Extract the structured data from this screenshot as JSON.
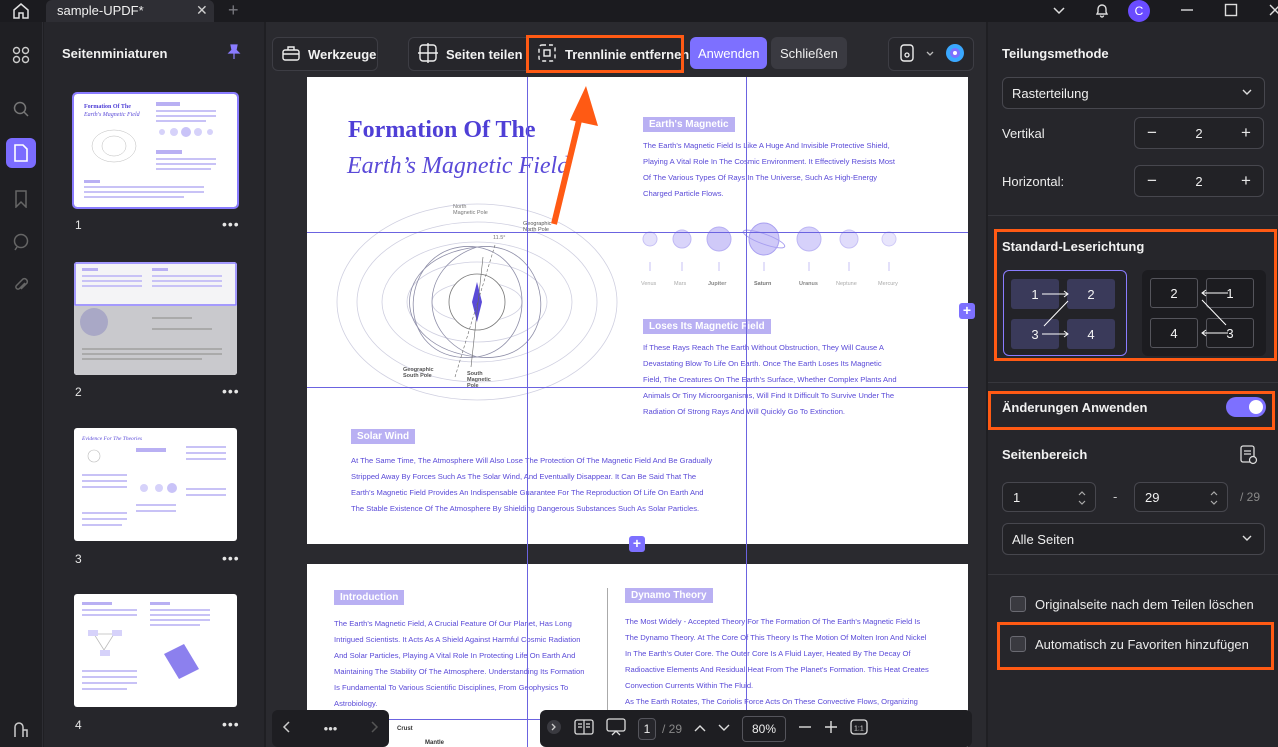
{
  "titlebar": {
    "tab_title": "sample-UPDF*",
    "tab_close": "✕",
    "new_tab": "+",
    "avatar_letter": "C"
  },
  "thumbnails": {
    "title": "Seitenminiaturen",
    "pages": [
      {
        "num": "1",
        "more": "•••"
      },
      {
        "num": "2",
        "more": "•••"
      },
      {
        "num": "3",
        "more": "•••"
      },
      {
        "num": "4",
        "more": "•••"
      }
    ]
  },
  "toolbar": {
    "tools_label": "Werkzeuge",
    "split_label": "Seiten teilen",
    "remove_divider_label": "Trennlinie entfernen",
    "apply_label": "Anwenden",
    "close_label": "Schließen"
  },
  "page1": {
    "title_line1": "Formation Of The",
    "title_line2": "Earth’s Magnetic Field",
    "section1_chip": "Earth's Magnetic",
    "section1_lines": [
      "The Earth's Magnetic Field Is Like A Huge And Invisible Protective Shield,",
      "Playing A Vital Role In The Cosmic Environment. It Effectively Resists Most",
      "Of The Various Types Of Rays In The Universe, Such As High-Energy",
      "Charged Particle Flows."
    ],
    "planets": [
      "Venus",
      "Mars",
      "Jupiter",
      "Saturn",
      "Uranus",
      "Neptune",
      "Mercury"
    ],
    "section2_chip": "Loses Its Magnetic Field",
    "section2_lines": [
      "If These Rays Reach The Earth Without Obstruction, They Will Cause A",
      "Devastating Blow To Life On Earth. Once The Earth Loses Its Magnetic",
      "Field, The Creatures On The Earth's Surface, Whether Complex Plants And",
      "Animals Or Tiny Microorganisms, Will Find It Difficult To Survive Under The",
      "Radiation Of Strong Rays And Will Quickly Go To Extinction."
    ],
    "diagram_labels": {
      "north_mag": "North\nMagnetic Pole",
      "geo_north": "Geographic\nNorth Pole",
      "geo_south": "Geographic\nSouth Pole",
      "south_mag": "South\nMagnetic\nPole",
      "angle": "11.5°"
    },
    "section3_chip": "Solar Wind",
    "section3_lines": [
      "At The Same Time, The Atmosphere Will Also Lose The Protection Of The Magnetic Field And Be Gradually",
      "Stripped Away By Forces Such As The Solar Wind, And Eventually Disappear. It Can Be Said That The",
      "Earth's Magnetic Field Provides An Indispensable Guarantee For The Reproduction Of Life On Earth And",
      "The Stable Existence Of The Atmosphere By Shielding Dangerous Substances Such As Solar Particles."
    ]
  },
  "page2": {
    "intro_chip": "Introduction",
    "intro_lines": [
      "The Earth's Magnetic Field, A Crucial Feature Of Our Planet, Has Long",
      "Intrigued Scientists. It Acts As A Shield Against Harmful Cosmic Radiation",
      "And Solar Particles, Playing A Vital Role In Protecting Life On Earth And",
      "Maintaining The Stability Of The Atmosphere. Understanding Its Formation",
      "Is Fundamental To Various Scientific Disciplines, From Geophysics To",
      "Astrobiology."
    ],
    "dynamo_chip": "Dynamo Theory",
    "dynamo_lines": [
      "The Most Widely - Accepted Theory For The Formation Of The Earth's Magnetic Field Is",
      "The Dynamo Theory. At The Core Of This Theory Is The Motion Of Molten Iron And Nickel",
      "In The Earth's Outer Core. The Outer Core Is A Fluid Layer, Heated By The Decay Of",
      "Radioactive Elements And Residual Heat From The Planet's Formation. This Heat Creates",
      "Convection Currents Within The Fluid.",
      "As The Earth Rotates, The Coriolis Force Acts On These Convective Flows, Organizing"
    ],
    "crust_label": "Crust",
    "mantle_label": "Mantle"
  },
  "bottombar": {
    "more": "•••",
    "page_current": "1",
    "page_total": "/ 29",
    "zoom": "80%"
  },
  "rightpanel": {
    "method_title": "Teilungsmethode",
    "method_value": "Rasterteilung",
    "vertical_label": "Vertikal",
    "vertical_value": "2",
    "horizontal_label": "Horizontal:",
    "horizontal_value": "2",
    "reading_title": "Standard-Leserichtung",
    "ltr": [
      "1",
      "2",
      "3",
      "4"
    ],
    "rtl": [
      "2",
      "1",
      "4",
      "3"
    ],
    "apply_changes_label": "Änderungen Anwenden",
    "range_title": "Seitenbereich",
    "range_from": "1",
    "range_dash": "-",
    "range_to": "29",
    "range_total": "/ 29",
    "pages_value": "Alle Seiten",
    "delete_original_label": "Originalseite nach dem Teilen löschen",
    "add_favorites_label": "Automatisch zu Favoriten hinzufügen"
  },
  "colors": {
    "accent": "#7d70ff",
    "highlight": "#ff5a14",
    "doc_text": "#5a4ad8"
  }
}
